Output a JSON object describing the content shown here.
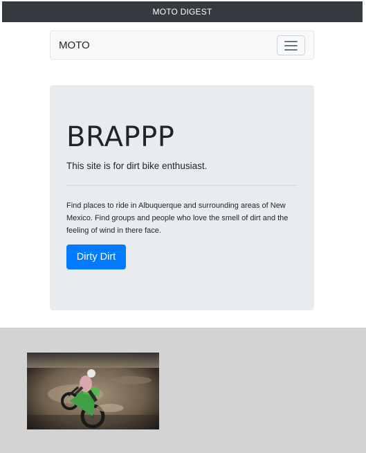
{
  "top_banner": {
    "title": "MOTO DIGEST"
  },
  "navbar": {
    "brand": "MOTO",
    "toggle_icon": "hamburger-menu-icon"
  },
  "hero": {
    "heading": "BRAPPP",
    "lead": "This site is for dirt bike enthusiast.",
    "description": "Find places to ride in Albuquerque and surrounding areas of New Mexico. Find groups and people who love the smell of dirt and the feeling of wind in there face.",
    "button_label": "Dirty Dirt"
  },
  "colors": {
    "banner_bg": "#343a40",
    "navbar_bg": "#f8f9fa",
    "jumbotron_bg": "#e9ecef",
    "button_bg": "#007bff",
    "section_bg": "#d3d3d3"
  }
}
